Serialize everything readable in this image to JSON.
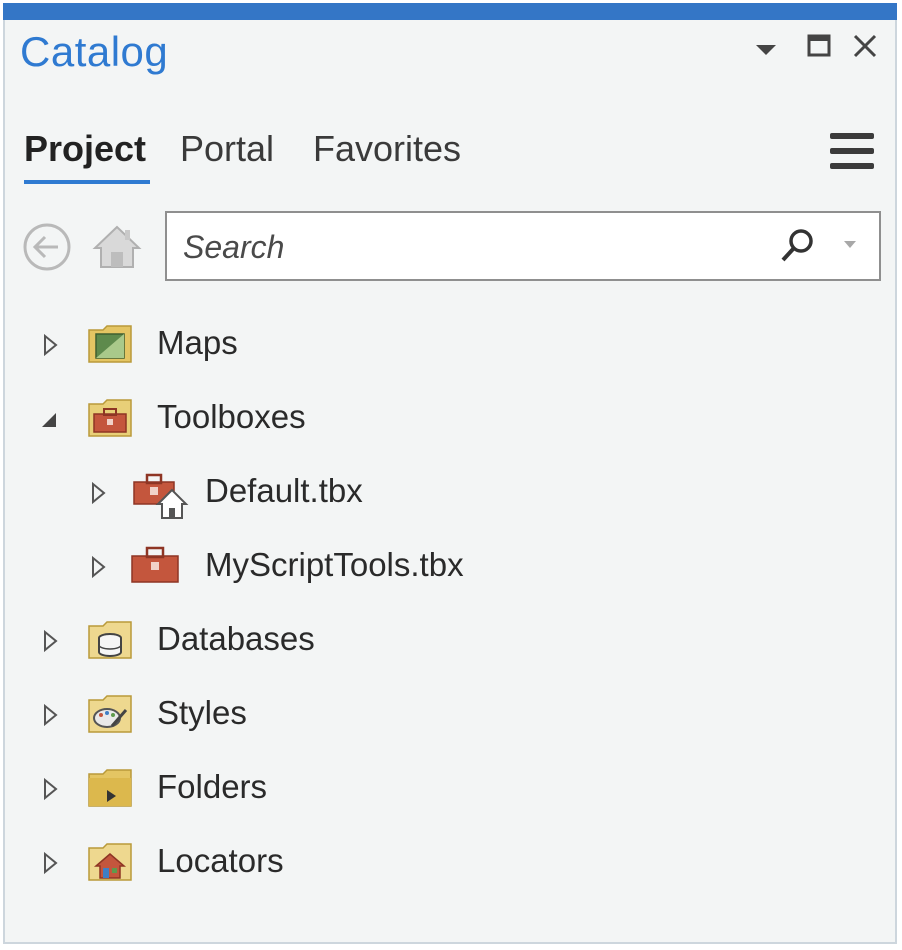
{
  "window": {
    "title": "Catalog",
    "controls": [
      "options-dropdown",
      "maximize",
      "close"
    ]
  },
  "tabs": [
    {
      "label": "Project",
      "active": true
    },
    {
      "label": "Portal",
      "active": false
    },
    {
      "label": "Favorites",
      "active": false
    }
  ],
  "toolbar": {
    "back_icon": "back-arrow-icon",
    "home_icon": "home-icon",
    "menu_icon": "hamburger-menu-icon"
  },
  "search": {
    "placeholder": "Search",
    "value": ""
  },
  "tree": {
    "items": [
      {
        "label": "Maps",
        "icon": "maps-folder-icon",
        "expanded": false,
        "level": 0
      },
      {
        "label": "Toolboxes",
        "icon": "toolboxes-folder-icon",
        "expanded": true,
        "level": 0
      },
      {
        "label": "Default.tbx",
        "icon": "default-toolbox-icon",
        "expanded": false,
        "level": 1
      },
      {
        "label": "MyScriptTools.tbx",
        "icon": "toolbox-icon",
        "expanded": false,
        "level": 1
      },
      {
        "label": "Databases",
        "icon": "databases-folder-icon",
        "expanded": false,
        "level": 0
      },
      {
        "label": "Styles",
        "icon": "styles-folder-icon",
        "expanded": false,
        "level": 0
      },
      {
        "label": "Folders",
        "icon": "folders-folder-icon",
        "expanded": false,
        "level": 0
      },
      {
        "label": "Locators",
        "icon": "locators-folder-icon",
        "expanded": false,
        "level": 0
      }
    ]
  },
  "colors": {
    "accent": "#2f7ad1",
    "topbar": "#3476c6",
    "panel_bg": "#f3f5f5",
    "folder": "#e8c96b",
    "toolbox": "#c4563d"
  }
}
